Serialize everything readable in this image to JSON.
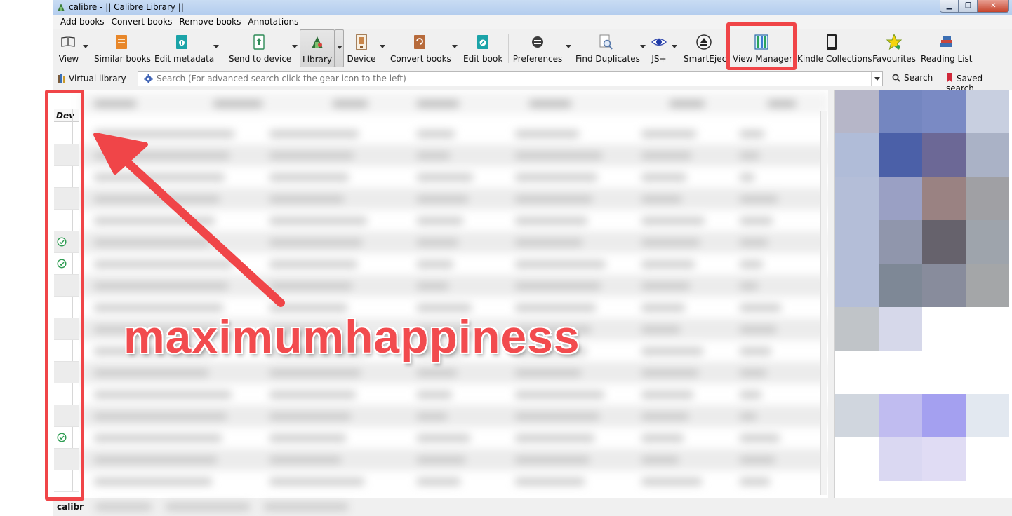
{
  "window": {
    "title": "calibre - || Calibre Library ||",
    "buttons": [
      "▁",
      "❐",
      "✕"
    ]
  },
  "menubar": [
    "Add books",
    "Convert books",
    "Remove books",
    "Annotations"
  ],
  "toolbar": {
    "view": "View",
    "similar_books": "Similar books",
    "edit_metadata": "Edit metadata",
    "send_to_device": "Send to device",
    "library": "Library",
    "device": "Device",
    "convert_books": "Convert books",
    "edit_book": "Edit book",
    "preferences": "Preferences",
    "find_duplicates": "Find Duplicates",
    "js_plus": "JS+",
    "smart_eject": "SmartEject",
    "view_manager": "View Manager",
    "kindle_collections": "Kindle Collections",
    "favourites": "Favourites",
    "reading_list": "Reading List"
  },
  "searchrow": {
    "virtual_library": "Virtual library",
    "search_placeholder": "Search (For advanced search click the gear icon to the left)",
    "search_button": "Search",
    "saved_search": "Saved search"
  },
  "book_list": {
    "device_column_header": "Dev",
    "device_checks": [
      false,
      false,
      false,
      false,
      false,
      true,
      true,
      false,
      false,
      false,
      false,
      false,
      false,
      false,
      true,
      false,
      false
    ]
  },
  "status": {
    "text": "calibr"
  },
  "annotation": {
    "text": "maximumhappiness",
    "color": "#f04548"
  },
  "colors": {
    "accent_red": "#f04548",
    "check_green": "#2e9c52"
  }
}
